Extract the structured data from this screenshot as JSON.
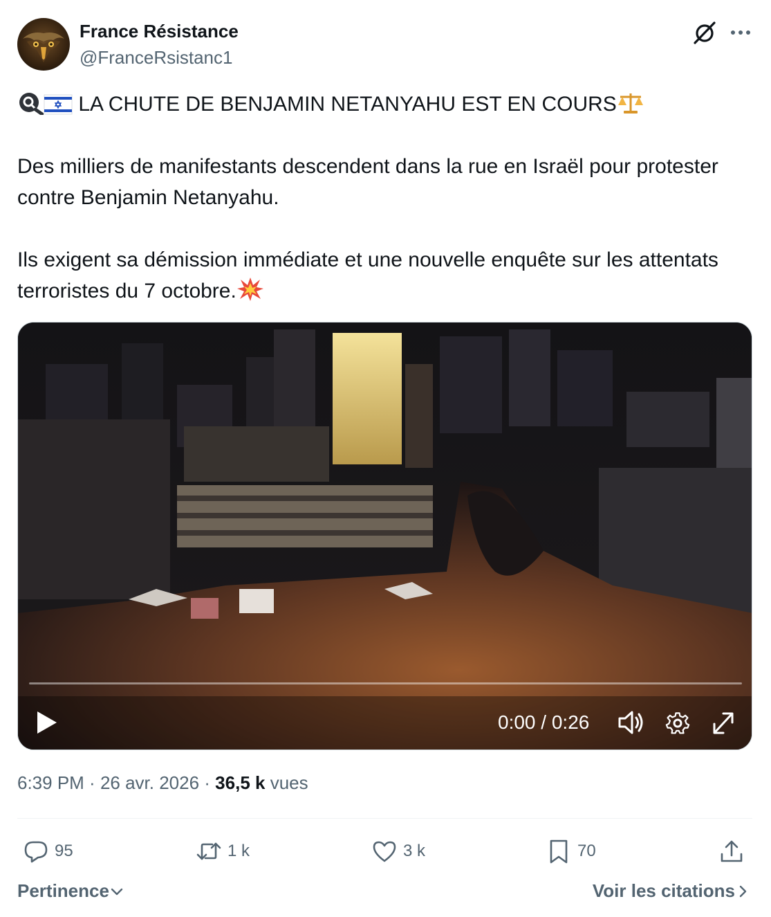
{
  "author": {
    "name": "France Résistance",
    "handle": "@FranceRsistanc1"
  },
  "tweet": {
    "headline": "LA CHUTE DE BENJAMIN NETANYAHU EST EN COURS",
    "paragraph_1": "Des milliers de manifestants descendent dans la rue en Israël pour protester contre Benjamin Netanyahu.",
    "paragraph_2": "Ils exigent sa démission immédiate et une nouvelle enquête sur les attentats terroristes du 7 octobre.",
    "leading_icons": [
      "search-icon",
      "israel-flag-icon"
    ],
    "trailing_icon_headline": "balance-scale-icon",
    "trailing_icon_paragraph_2": "collision-icon"
  },
  "video": {
    "current_time": "0:00",
    "duration": "0:26",
    "time_separator": " / ",
    "progress": 0
  },
  "meta": {
    "time": "6:39 PM",
    "separator": " · ",
    "date": "26 avr. 2026",
    "views_count": "36,5 k",
    "views_label": "vues"
  },
  "actions": {
    "replies": "95",
    "reposts": "1 k",
    "likes": "3 k",
    "bookmarks": "70"
  },
  "footer": {
    "sort_label": "Pertinence",
    "quotes_label": "Voir les citations"
  },
  "colors": {
    "text_primary": "#0f1419",
    "text_secondary": "#536471",
    "divider": "#eff3f4"
  }
}
